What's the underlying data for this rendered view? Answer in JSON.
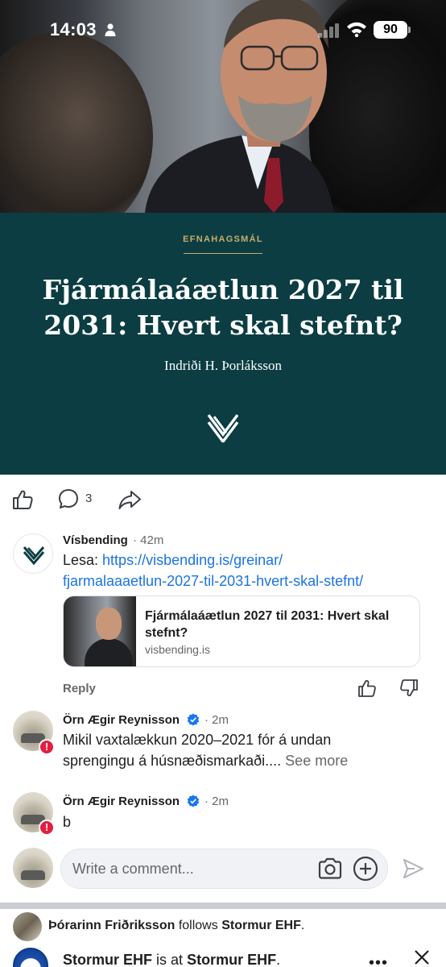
{
  "status_bar": {
    "time": "14:03",
    "battery": "90"
  },
  "article": {
    "category": "EFNAHAGSMÁL",
    "title": "Fjármálaáætlun 2027 til 2031: Hvert skal stefnt?",
    "author": "Indriði H. Þorláksson"
  },
  "actions": {
    "comment_count": "3"
  },
  "comments": [
    {
      "author": "Vísbending",
      "time": "· 42m",
      "text_prefix": "Lesa: ",
      "link_line1": "https://visbending.is/greinar/",
      "link_line2": "fjarmalaaaetlun-2027-til-2031-hvert-skal-stefnt/",
      "card": {
        "title": "Fjármálaáætlun 2027 til 2031: Hvert skal stefnt?",
        "domain": "visbending.is"
      },
      "reply": "Reply"
    },
    {
      "author": "Örn Ægir Reynisson",
      "time": "· 2m",
      "line1": "Mikil vaxtalækkun 2020–2021 fór á undan",
      "line2": "sprengingu á húsnæðismarkaði....",
      "see_more": "See more",
      "badge": "!"
    },
    {
      "author": "Örn Ægir Reynisson",
      "time": "· 2m",
      "text": "b",
      "badge": "!"
    }
  ],
  "composer": {
    "placeholder": "Write a comment..."
  },
  "feed": {
    "follow": {
      "person": "Þórarinn Friðriksson",
      "verb": "follows",
      "target": "Stormur EHF",
      "end": "."
    },
    "post": {
      "page": "Stormur EHF",
      "verb": "is at",
      "place": "Stormur EHF",
      "end": ".",
      "more": "•••"
    }
  },
  "colors": {
    "banner": "#0b3d42",
    "accent": "#c9ad6a",
    "link": "#1b74e4",
    "verified": "#1877f2",
    "alert": "#e41e3f"
  },
  "icons": [
    "person-icon",
    "signal-icon",
    "wifi-icon",
    "like-icon",
    "comment-icon",
    "share-icon",
    "verified-icon",
    "camera-icon",
    "plus-icon",
    "send-icon",
    "close-icon"
  ]
}
